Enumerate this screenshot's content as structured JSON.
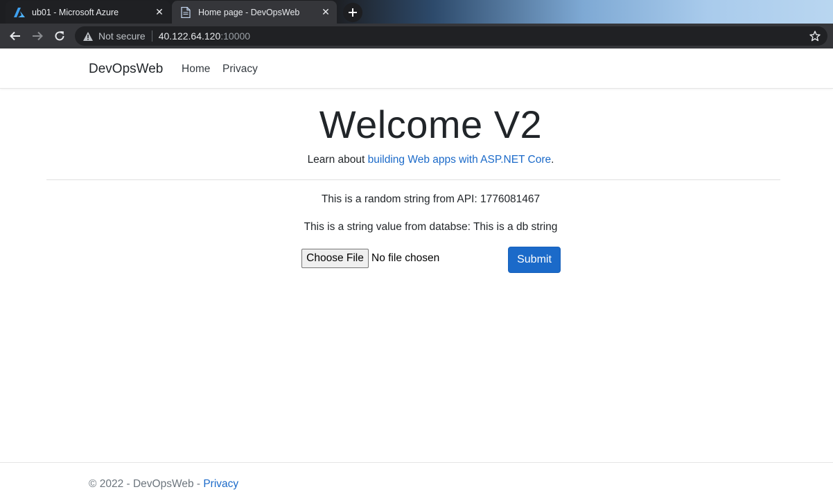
{
  "browser": {
    "tabs": [
      {
        "title": "ub01 - Microsoft Azure",
        "icon": "azure-logo-icon",
        "active": false
      },
      {
        "title": "Home page - DevOpsWeb",
        "icon": "page-icon",
        "active": true
      }
    ],
    "address": {
      "security_label": "Not secure",
      "host": "40.122.64.120",
      "port": ":10000"
    }
  },
  "navbar": {
    "brand": "DevOpsWeb",
    "links": [
      "Home",
      "Privacy"
    ]
  },
  "main": {
    "heading": "Welcome V2",
    "lead_prefix": "Learn about ",
    "lead_link": "building Web apps with ASP.NET Core",
    "lead_suffix": ".",
    "api_line": "This is a random string from API: 1776081467",
    "db_line": "This is a string value from databse: This is a db string",
    "file_button": "Choose File",
    "file_status": "No file chosen",
    "submit_label": "Submit"
  },
  "footer": {
    "copyright": "© 2022 - DevOpsWeb - ",
    "privacy_link": "Privacy"
  },
  "colors": {
    "link": "#1b6ac9",
    "primary_button": "#1b6ac9",
    "chrome_dark": "#35363a"
  }
}
